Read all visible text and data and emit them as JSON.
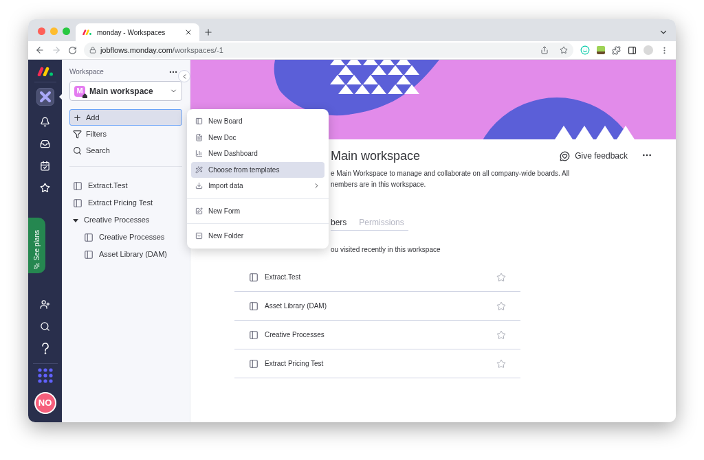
{
  "browser": {
    "tab_title": "monday - Workspaces",
    "url_host": "jobflows.monday.com",
    "url_path": "/workspaces/-1"
  },
  "nav": {
    "items": [
      {
        "kind": "workspaces",
        "selected": true
      },
      {
        "kind": "notifications",
        "selected": false
      },
      {
        "kind": "inbox",
        "selected": false
      },
      {
        "kind": "my-work",
        "selected": false
      },
      {
        "kind": "favorites",
        "selected": false
      }
    ],
    "see_plans": "See plans",
    "bottom": [
      {
        "kind": "invite"
      },
      {
        "kind": "search"
      },
      {
        "kind": "help"
      }
    ],
    "avatar": "NO"
  },
  "sidebar": {
    "label": "Workspace",
    "workspace": {
      "initial": "M",
      "name": "Main workspace"
    },
    "actions": [
      {
        "kind": "add",
        "label": "Add",
        "selected": true
      },
      {
        "kind": "filter",
        "label": "Filters",
        "selected": false
      },
      {
        "kind": "search",
        "label": "Search",
        "selected": false
      }
    ],
    "tree": [
      {
        "label": "Extract.Test",
        "kind": "board"
      },
      {
        "label": "Extract Pricing Test",
        "kind": "board"
      },
      {
        "label": "Creative Processes",
        "kind": "folder",
        "expanded": true,
        "children": [
          {
            "label": "Creative Processes",
            "kind": "board"
          },
          {
            "label": "Asset Library (DAM)",
            "kind": "board"
          }
        ]
      }
    ]
  },
  "menu": {
    "groups": [
      [
        {
          "kind": "board",
          "label": "New Board",
          "selected": false,
          "submenu": false
        },
        {
          "kind": "doc",
          "label": "New Doc",
          "selected": false,
          "submenu": false
        },
        {
          "kind": "dashboard",
          "label": "New Dashboard",
          "selected": false,
          "submenu": false
        },
        {
          "kind": "templates",
          "label": "Choose from templates",
          "selected": true,
          "submenu": false
        },
        {
          "kind": "import",
          "label": "Import data",
          "selected": false,
          "submenu": true
        }
      ],
      [
        {
          "kind": "form",
          "label": "New Form",
          "selected": false,
          "submenu": false
        }
      ],
      [
        {
          "kind": "folder",
          "label": "New Folder",
          "selected": false,
          "submenu": false
        }
      ]
    ]
  },
  "main": {
    "title": "Main workspace",
    "feedback": "Give feedback",
    "description": [
      "e Main Workspace to manage and collaborate on all company-wide boards. All",
      "nembers are in this workspace."
    ],
    "tabs": [
      {
        "label": "bers",
        "selected": true
      },
      {
        "label": "Permissions",
        "selected": false
      }
    ],
    "recent_caption": "ou visited recently in this workspace",
    "boards": [
      {
        "name": "Extract.Test",
        "starred": false
      },
      {
        "name": "Asset Library (DAM)",
        "starred": false
      },
      {
        "name": "Creative Processes",
        "starred": false
      },
      {
        "name": "Extract Pricing Test",
        "starred": false
      }
    ]
  }
}
